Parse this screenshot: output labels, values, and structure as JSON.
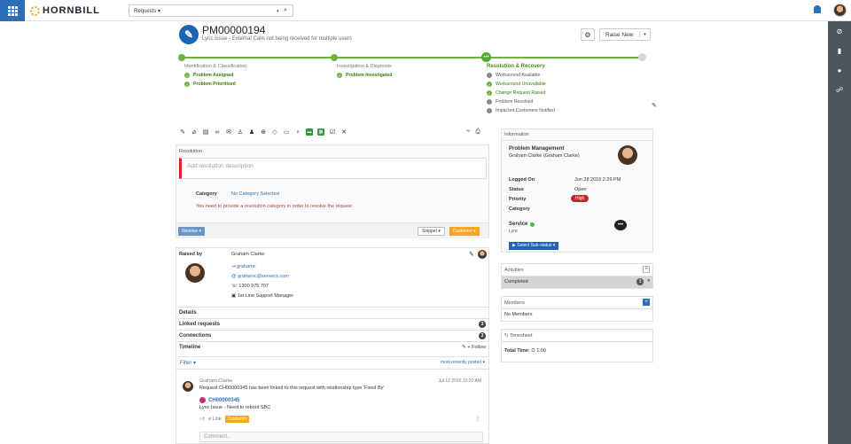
{
  "topbar": {
    "brand": "HORNBILL",
    "search_scope": "Requests ▾"
  },
  "request": {
    "reference": "PM00000194",
    "summary": "Lync Issue - External Calls not being received for multiple users",
    "raise_new": "Raise New"
  },
  "stages": [
    {
      "title": "Identification & Classification",
      "tasks": [
        "Problem Assigned",
        "Problem Prioritised"
      ]
    },
    {
      "title": "Investigation & Diagnosis",
      "tasks": [
        "Problem Investigated"
      ]
    },
    {
      "title": "Resolution & Recovery",
      "tasks": [
        {
          "label": "Workaround Available",
          "state": "pending"
        },
        {
          "label": "Workaround Unavailable",
          "state": "done"
        },
        {
          "label": "Change Request Raised",
          "state": "done"
        },
        {
          "label": "Problem Resolved",
          "state": "pending"
        },
        {
          "label": "Impacted Customers Notified",
          "state": "pending"
        }
      ]
    }
  ],
  "resolution": {
    "section_label": "Resolution",
    "placeholder": "Add resolution description",
    "category_label": "Category",
    "category_value": "No Category Selected",
    "warning": "You need to provide a resolution category in order to resolve the request",
    "resolve_button": "Resolve ▾",
    "snippet_button": "Snippet ▾",
    "customer_button": "Customer ▾"
  },
  "raised_by": {
    "label": "Raised by",
    "name": "Graham Clarke",
    "username": "grahamc",
    "email": "grahamc@servecs.com",
    "phone": "1300 975 707",
    "role": "1st Line Support Manager"
  },
  "sections": {
    "details": "Details",
    "linked": "Linked requests",
    "linked_count": "3",
    "connections": "Connections",
    "connections_count": "3",
    "timeline": "Timeline",
    "follow": "Follow"
  },
  "timeline": {
    "filter": "Filter ▾",
    "sort": "most recently posted ▾",
    "post": {
      "author": "Graham Clarke",
      "date": "Jul 12 2016 10:22 AM",
      "text": "Request CH00000345 has been linked to this request with relationship type 'Fixed By'",
      "change_ref": "CH00000345",
      "change_summary": "Lync Issue - Need to reboot SBC",
      "link_label": "Link",
      "customer_label": "Customer"
    },
    "comment_placeholder": "Comment..."
  },
  "info": {
    "header": "Information",
    "team": "Problem Management",
    "owner": "Graham Clarke (Graham Clarke)",
    "logged_on_label": "Logged On",
    "logged_on": "Jun 28 2016 2:26 PM",
    "status_label": "Status",
    "status": "Open",
    "priority_label": "Priority",
    "priority": "High",
    "category_label": "Category",
    "service_label": "Service",
    "service": "Lync",
    "substatus": "Select Sub-status ▾"
  },
  "activities": {
    "header": "Activities",
    "completed_label": "Completed",
    "completed_count": "3"
  },
  "members": {
    "header": "Members",
    "empty": "No Members"
  },
  "timesheet": {
    "header": "Timesheet",
    "total_label": "Total Time:",
    "total": "1:00"
  },
  "colors": {
    "brand_blue": "#2c6fb7",
    "progress_green": "#6cb33f",
    "priority_high": "#c8262f",
    "customer_orange": "#f5a623"
  }
}
